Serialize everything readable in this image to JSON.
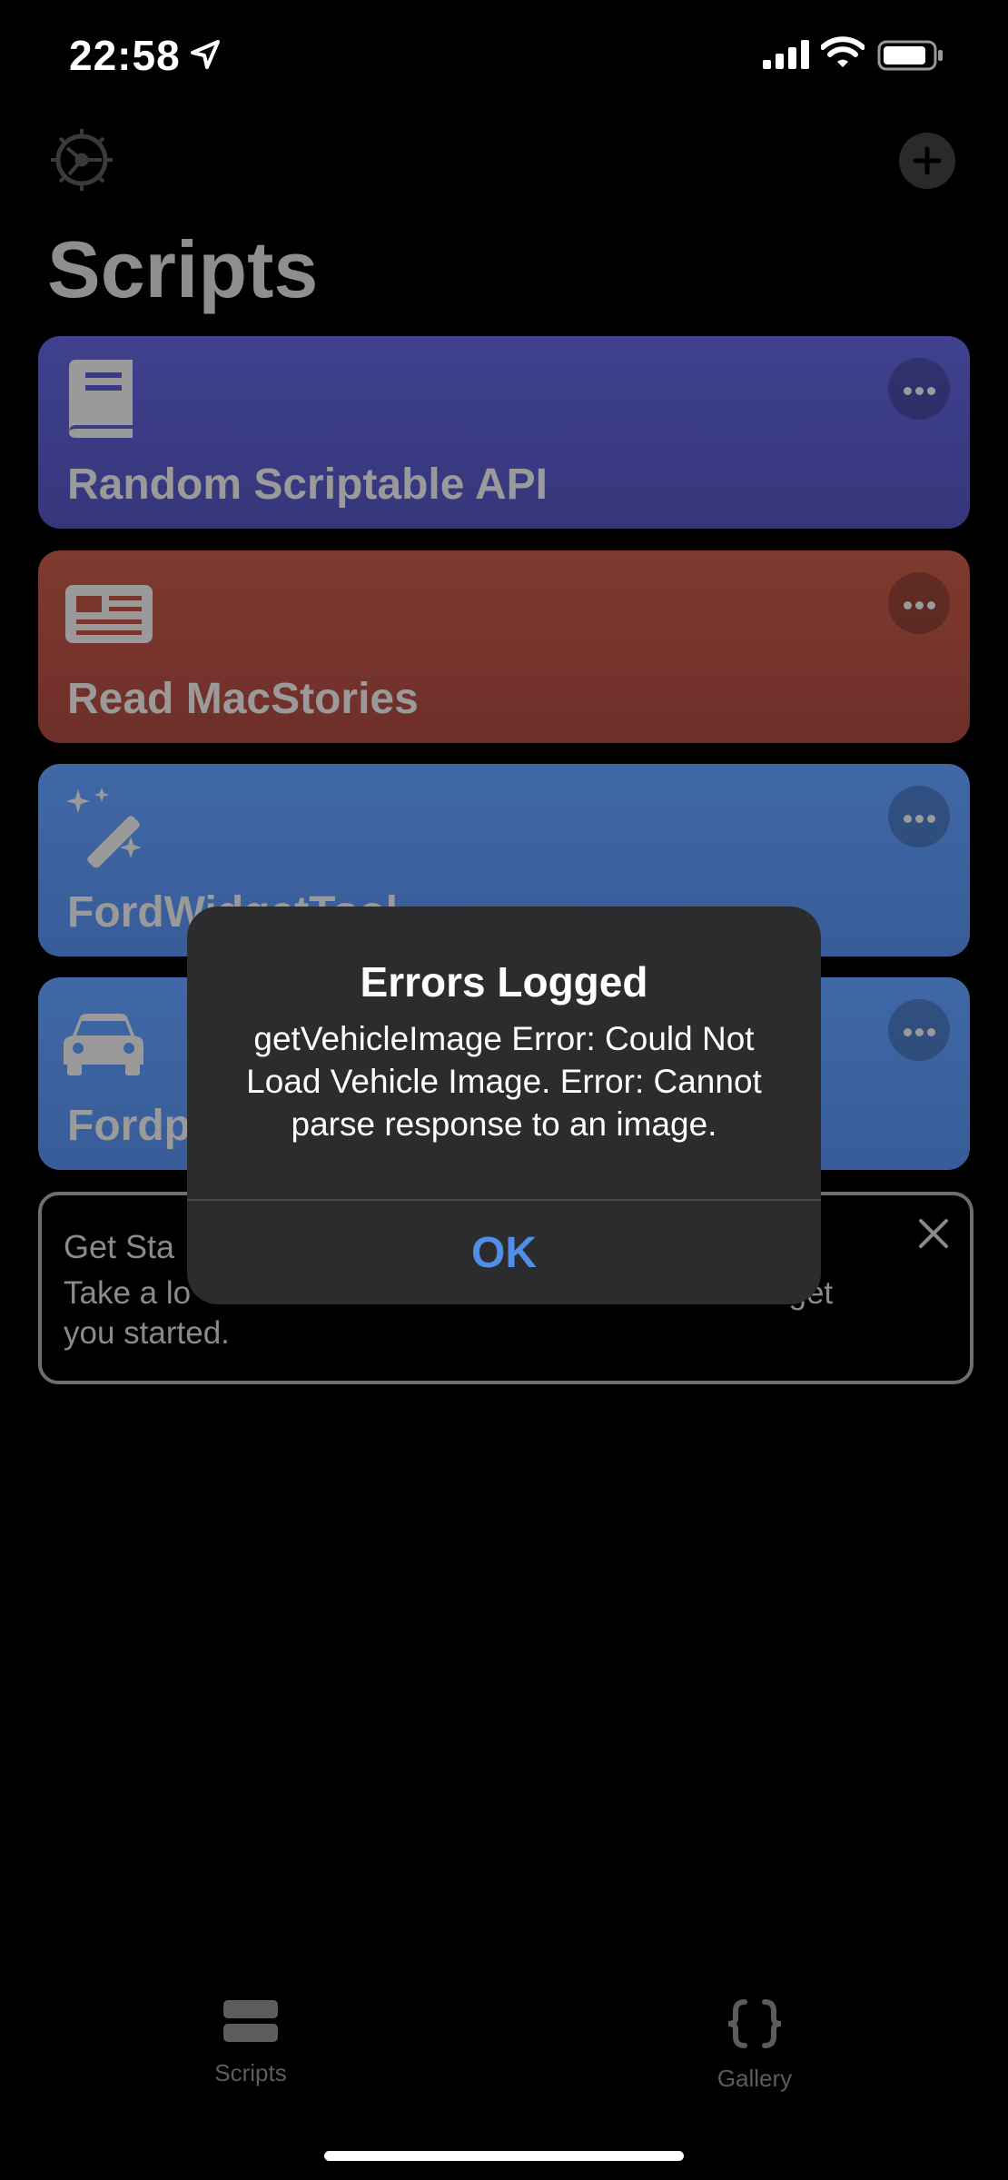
{
  "status_bar": {
    "time": "22:58",
    "icons": [
      "location-arrow-icon",
      "cellular-signal-icon",
      "wifi-icon",
      "battery-icon"
    ]
  },
  "header": {
    "title": "Scripts",
    "settings_icon": "gear-icon",
    "add_icon": "plus-icon"
  },
  "scripts": [
    {
      "name": "Random Scriptable API",
      "icon": "book-icon",
      "color": "#3d3d8c"
    },
    {
      "name": "Read MacStories",
      "icon": "newspaper-icon",
      "color": "#7f3a2f"
    },
    {
      "name": "FordWidgetTool",
      "icon": "magic-wand-icon",
      "color": "#3f6aa8"
    },
    {
      "name": "Fordp",
      "icon": "car-icon",
      "color": "#3f6aa8"
    }
  ],
  "get_started": {
    "title": "Get Sta",
    "body_line1_a": "Take a lo",
    "body_line1_b": "to get",
    "body_line2": "you started."
  },
  "alert": {
    "title": "Errors Logged",
    "message": "getVehicleImage Error: Could Not Load Vehicle Image. Error: Cannot parse response to an image.",
    "button": "OK"
  },
  "tab_bar": {
    "tabs": [
      {
        "label": "Scripts",
        "icon": "stack-icon"
      },
      {
        "label": "Gallery",
        "icon": "braces-icon"
      }
    ]
  }
}
